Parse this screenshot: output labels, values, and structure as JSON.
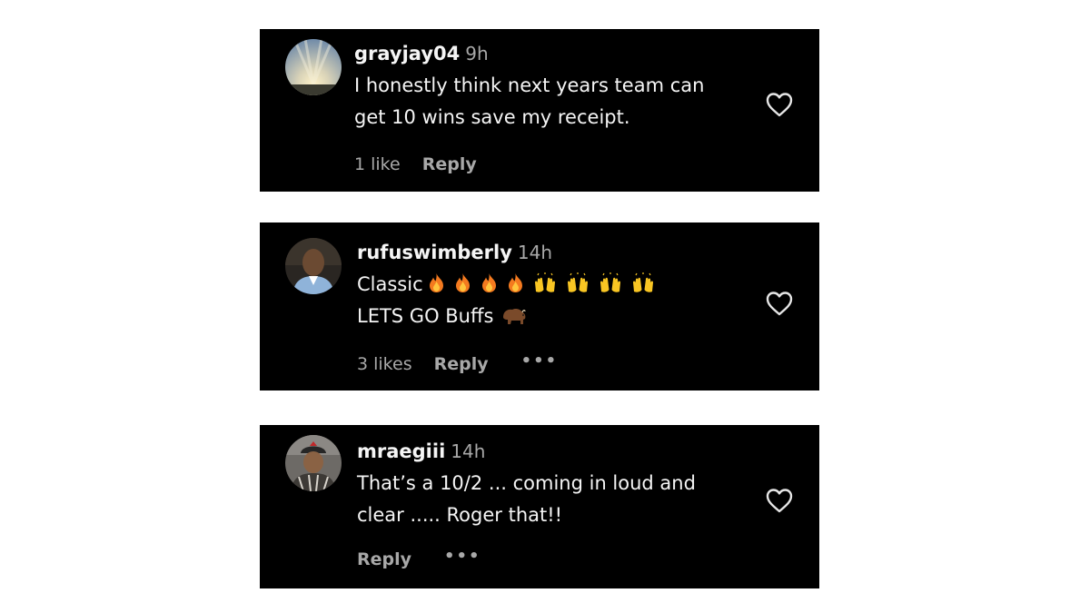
{
  "comments": [
    {
      "username": "grayjay04",
      "time": "9h",
      "lines": [
        "I honestly think next years team can",
        "get 10 wins save my receipt."
      ],
      "likes": "1 like",
      "reply": "Reply",
      "more": ""
    },
    {
      "username": "rufuswimberly",
      "time": "14h",
      "line1_text": "Classic",
      "line2_text": "LETS GO Buffs",
      "likes": "3 likes",
      "reply": "Reply",
      "more": "•••"
    },
    {
      "username": "mraegiii",
      "time": "14h",
      "lines": [
        "That’s a 10/2 ... coming in loud and",
        "clear ..... Roger that!!"
      ],
      "likes": "",
      "reply": "Reply",
      "more": "•••"
    }
  ],
  "icons": {
    "like": "heart-outline-icon",
    "fire": "fire-emoji",
    "raised_hands": "raised-hands-emoji",
    "bison": "bison-emoji"
  },
  "colors": {
    "card_bg": "#000000",
    "text": "#f5f5f5",
    "muted": "#a8a8a8",
    "page_bg": "#ffffff"
  }
}
